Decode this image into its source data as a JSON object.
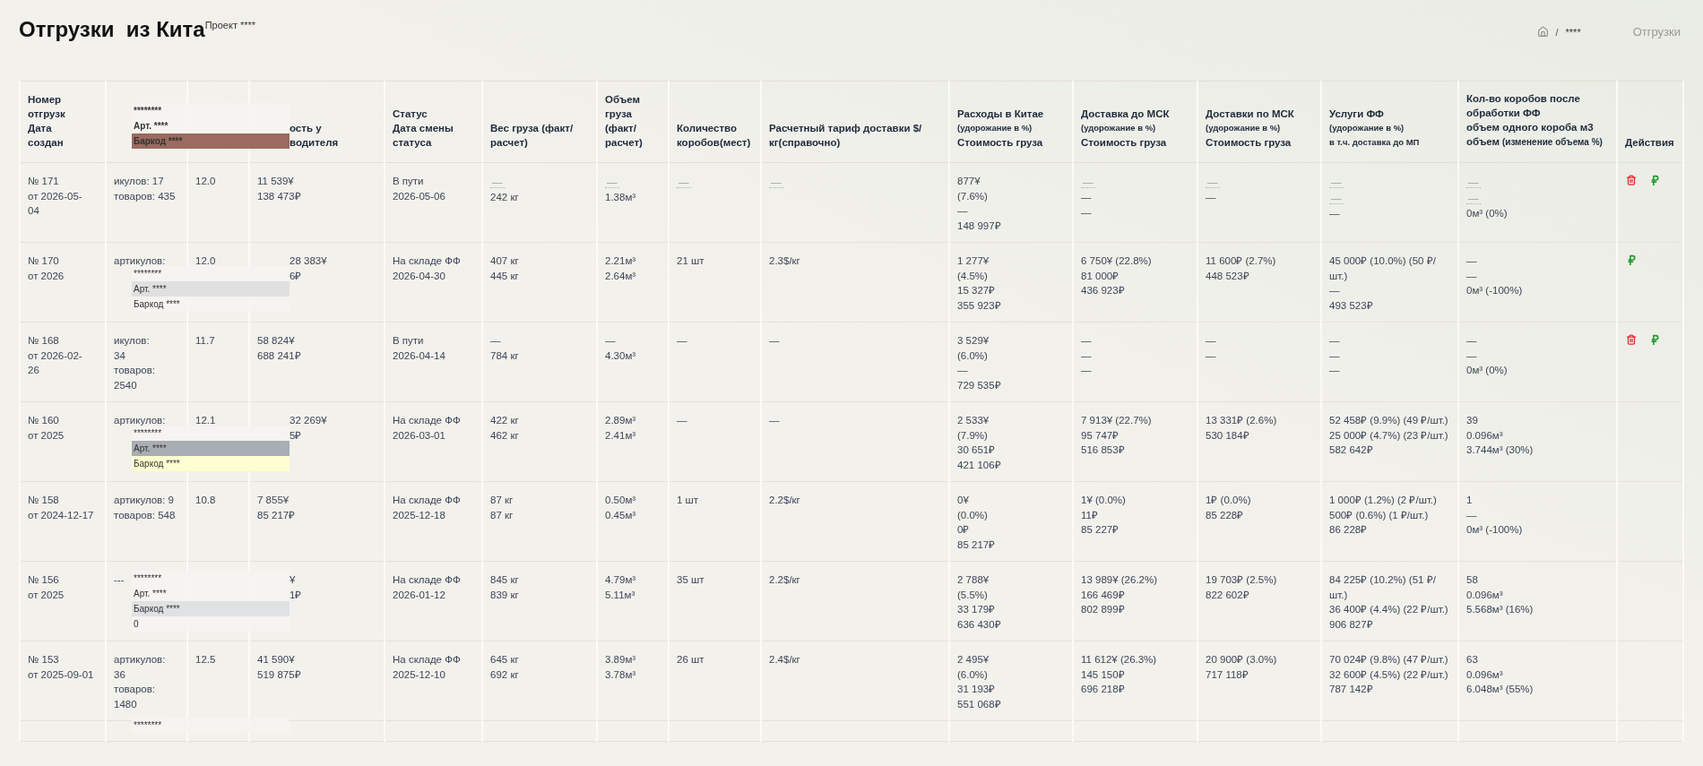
{
  "page": {
    "title": "Отгрузки  из Кита",
    "project": "Проект ****"
  },
  "breadcrumbs": {
    "items": [
      "****"
    ],
    "separator": "/",
    "current": "Отгрузки"
  },
  "table": {
    "columns": [
      {
        "lines": [
          {
            "kind": "title",
            "text": "Номер"
          },
          {
            "kind": "title",
            "text": "отгрузк"
          },
          {
            "kind": "title",
            "text": "Дата"
          },
          {
            "kind": "title",
            "text": "создан"
          }
        ]
      },
      {
        "popup": {
          "lines": [
            {
              "text": "********"
            },
            {
              "text": "Арт. ****"
            },
            {
              "text": "Баркод ****",
              "color": "#9a6b5e"
            }
          ]
        }
      },
      {},
      {
        "lines": [
          {
            "kind": "title",
            "text": "ость у"
          },
          {
            "kind": "title",
            "text": "водителя"
          }
        ]
      },
      {
        "lines": [
          {
            "kind": "title",
            "text": "Статус"
          },
          {
            "kind": "title",
            "text": "Дата смены статуса"
          }
        ]
      },
      {
        "lines": [
          {
            "kind": "title",
            "text": "Вес груза (факт/ расчет)"
          }
        ]
      },
      {
        "lines": [
          {
            "kind": "title",
            "text": "Объем груза (факт/ расчет)"
          }
        ]
      },
      {
        "lines": [
          {
            "kind": "title",
            "text": "Количество коробов(мест)"
          }
        ]
      },
      {
        "lines": [
          {
            "kind": "title",
            "text": "Расчетный тариф доставки $/кг(справочно)"
          }
        ]
      },
      {
        "lines": [
          {
            "kind": "title",
            "text": "Расходы в Китае"
          },
          {
            "kind": "note",
            "text": "(удорожание в %)"
          },
          {
            "kind": "title",
            "text": "Стоимость груза"
          }
        ]
      },
      {
        "lines": [
          {
            "kind": "title",
            "text": "Доставка до МСК"
          },
          {
            "kind": "note",
            "text": "(удорожание в %)"
          },
          {
            "kind": "title",
            "text": "Стоимость груза"
          }
        ]
      },
      {
        "lines": [
          {
            "kind": "title",
            "text": "Доставки по МСК"
          },
          {
            "kind": "note",
            "text": "(удорожание в %)"
          },
          {
            "kind": "title",
            "text": "Стоимость груза"
          }
        ]
      },
      {
        "lines": [
          {
            "kind": "title",
            "text": "Услуги ФФ"
          },
          {
            "kind": "note",
            "text": "(удорожание в %)"
          },
          {
            "kind": "note",
            "text": "в т.ч. доставка до МП"
          }
        ]
      },
      {
        "lines": [
          {
            "kind": "title",
            "text": "Кол-во коробов после обработки ФФ"
          },
          {
            "kind": "title",
            "text": "объем одного короба м3"
          },
          {
            "kind": "title",
            "text": "объем",
            "note": "(изменение объема %)"
          }
        ]
      },
      {
        "lines": [
          {
            "kind": "title",
            "text": "Действия"
          }
        ]
      }
    ],
    "rows": [
      {
        "cells": [
          [
            "№ 171",
            "от 2026-05-",
            "04"
          ],
          [
            "икулов: 17",
            "товаров: 435"
          ],
          [
            "12.0"
          ],
          [
            "11 539¥",
            "138 473₽"
          ],
          [
            "В пути",
            "2026-05-06"
          ],
          {
            "editable": [
              "—"
            ],
            "lines": [
              "242 кг"
            ]
          },
          {
            "editable": [
              "—"
            ],
            "lines": [
              "1.38м³"
            ]
          },
          {
            "editable": [
              "—"
            ]
          },
          {
            "editable": [
              "—"
            ]
          },
          [
            "877¥",
            "(7.6%)",
            "—",
            "148 997₽"
          ],
          {
            "editable": [
              "—"
            ],
            "lines": [
              "—",
              "—"
            ]
          },
          {
            "editable": [
              "—"
            ],
            "lines": [
              "—"
            ]
          },
          {
            "editable": [
              "—",
              "—"
            ],
            "lines": [
              "—"
            ]
          },
          {
            "editable": [
              "—",
              "—"
            ],
            "lines": [
              "0м³ (0%)"
            ]
          }
        ],
        "actions": [
          {
            "kind": "delete"
          },
          {
            "kind": "pay"
          }
        ]
      },
      {
        "cells": [
          [
            "№ 170",
            "от 2026"
          ],
          [
            "артикулов:"
          ],
          [
            "12.0"
          ],
          [
            "28 383¥",
            "6₽"
          ],
          [
            "На складе ФФ",
            "2026-04-30"
          ],
          [
            "407 кг",
            "445 кг"
          ],
          [
            "2.21м³",
            "2.64м³"
          ],
          [
            "21 шт"
          ],
          [
            "2.3$/кг"
          ],
          [
            "1 277¥",
            "(4.5%)",
            "15 327₽",
            "355 923₽"
          ],
          [
            "6 750¥ (22.8%)",
            "81 000₽",
            "436 923₽"
          ],
          [
            "11 600₽ (2.7%)",
            "448 523₽"
          ],
          [
            "45 000₽ (10.0%) (50 ₽/шт.)",
            "—",
            "493 523₽"
          ],
          [
            "—",
            "—",
            "0м³ (-100%)"
          ]
        ],
        "actions": [
          {
            "kind": "pay"
          }
        ],
        "popup": {
          "lines": [
            {
              "text": "********"
            },
            {
              "text": "Арт. ****",
              "color": "#e0e0e0"
            },
            {
              "text": "Баркод ****"
            }
          ]
        }
      },
      {
        "cells": [
          [
            "№ 168",
            "от 2026-02-",
            "26"
          ],
          [
            "икулов:",
            "34",
            "товаров:",
            "2540"
          ],
          [
            "11.7"
          ],
          [
            "58 824¥",
            "688 241₽"
          ],
          [
            "В пути",
            "2026-04-14"
          ],
          [
            "—",
            "784 кг"
          ],
          [
            "—",
            "4.30м³"
          ],
          [
            "—"
          ],
          [
            "—"
          ],
          [
            "3 529¥",
            "(6.0%)",
            "—",
            "729 535₽"
          ],
          [
            "—",
            "—",
            "—"
          ],
          [
            "—",
            "—"
          ],
          [
            "—",
            "—",
            "—"
          ],
          [
            "—",
            "—",
            "0м³ (0%)"
          ]
        ],
        "actions": [
          {
            "kind": "delete"
          },
          {
            "kind": "pay"
          }
        ]
      },
      {
        "cells": [
          [
            "№ 160",
            "от 2025"
          ],
          [
            "артикулов:"
          ],
          [
            "12.1"
          ],
          [
            "32 269¥",
            "5₽"
          ],
          [
            "На складе ФФ",
            "2026-03-01"
          ],
          [
            "422 кг",
            "462 кг"
          ],
          [
            "2.89м³",
            "2.41м³"
          ],
          [
            "—"
          ],
          [
            "—"
          ],
          [
            "2 533¥",
            "(7.9%)",
            "30 651₽",
            "421 106₽"
          ],
          [
            "7 913¥ (22.7%)",
            "95 747₽",
            "516 853₽"
          ],
          [
            "13 331₽ (2.6%)",
            "530 184₽"
          ],
          [
            "52 458₽ (9.9%) (49 ₽/шт.)",
            "25 000₽ (4.7%) (23 ₽/шт.)",
            "582 642₽"
          ],
          [
            "39",
            "0.096м³",
            "3.744м³ (30%)"
          ]
        ],
        "actions": [],
        "popup": {
          "lines": [
            {
              "text": "********"
            },
            {
              "text": "Арт. ****",
              "color": "#a9aeb4"
            },
            {
              "text": "Баркод ****",
              "color": "#fefed2"
            }
          ]
        }
      },
      {
        "cells": [
          [
            "№ 158",
            "от 2024-12-17"
          ],
          [
            "артикулов: 9",
            "товаров: 548"
          ],
          [
            "10.8"
          ],
          [
            "7 855¥",
            "85 217₽"
          ],
          [
            "На складе ФФ",
            "2025-12-18"
          ],
          [
            "87 кг",
            "87 кг"
          ],
          [
            "0.50м³",
            "0.45м³"
          ],
          [
            "1 шт"
          ],
          [
            "2.2$/кг"
          ],
          [
            "0¥",
            "(0.0%)",
            "0₽",
            "85 217₽"
          ],
          [
            "1¥ (0.0%)",
            "11₽",
            "85 227₽"
          ],
          [
            "1₽ (0.0%)",
            "85 228₽"
          ],
          [
            "1 000₽ (1.2%) (2 ₽/шт.)",
            "500₽ (0.6%) (1 ₽/шт.)",
            "86 228₽"
          ],
          [
            "1",
            "—",
            "0м³ (-100%)"
          ]
        ],
        "actions": []
      },
      {
        "cells": [
          [
            "№ 156",
            "от 2025"
          ],
          [
            "---"
          ],
          [],
          [
            "¥",
            "1₽"
          ],
          [
            "На складе ФФ",
            "2026-01-12"
          ],
          [
            "845 кг",
            "839 кг"
          ],
          [
            "4.79м³",
            "5.11м³"
          ],
          [
            "35 шт"
          ],
          [
            "2.2$/кг"
          ],
          [
            "2 788¥",
            "(5.5%)",
            "33 179₽",
            "636 430₽"
          ],
          [
            "13 989¥ (26.2%)",
            "166 469₽",
            "802 899₽"
          ],
          [
            "19 703₽ (2.5%)",
            "822 602₽"
          ],
          [
            "84 225₽ (10.2%) (51 ₽/шт.)",
            "36 400₽ (4.4%) (22 ₽/шт.)",
            "906 827₽"
          ],
          [
            "58",
            "0.096м³",
            "5.568м³ (16%)"
          ]
        ],
        "actions": [],
        "popup": {
          "lines": [
            {
              "text": "********"
            },
            {
              "text": "Арт. ****"
            },
            {
              "text": "Баркод ****",
              "color": "#dfe1e3"
            },
            {
              "text": "0"
            }
          ]
        }
      },
      {
        "cells": [
          [
            "№ 153",
            "от 2025-09-01"
          ],
          [
            "артикулов:",
            "36",
            "товаров:",
            "1480"
          ],
          [
            "12.5"
          ],
          [
            "41 590¥",
            "519 875₽"
          ],
          [
            "На складе ФФ",
            "2025-12-10"
          ],
          [
            "645 кг",
            "692 кг"
          ],
          [
            "3.89м³",
            "3.78м³"
          ],
          [
            "26 шт"
          ],
          [
            "2.4$/кг"
          ],
          [
            "2 495¥",
            "(6.0%)",
            "31 193₽",
            "551 068₽"
          ],
          [
            "11 612¥ (26.3%)",
            "145 150₽",
            "696 218₽"
          ],
          [
            "20 900₽ (3.0%)",
            "717 118₽"
          ],
          [
            "70 024₽ (9.8%) (47 ₽/шт.)",
            "32 600₽ (4.5%) (22 ₽/шт.)",
            "787 142₽"
          ],
          [
            "63",
            "0.096м³",
            "6.048м³ (55%)"
          ]
        ],
        "actions": []
      },
      {
        "cells": [
          [],
          [],
          [],
          [],
          [],
          [],
          [],
          [],
          [],
          [],
          [],
          [],
          [],
          []
        ],
        "actions": [],
        "popup": {
          "lines": [
            {
              "text": "********"
            }
          ]
        }
      }
    ]
  }
}
